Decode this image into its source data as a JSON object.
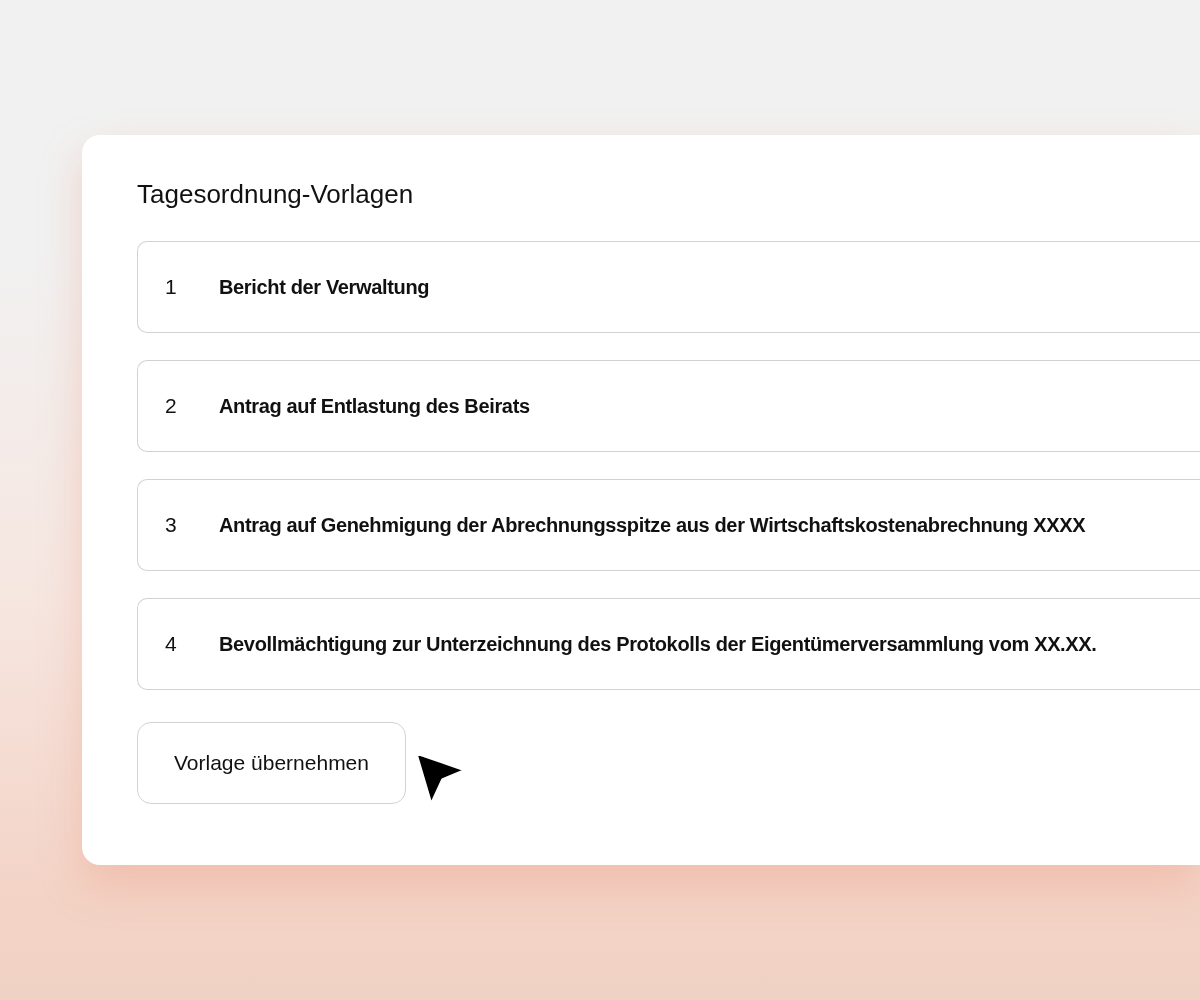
{
  "panel": {
    "title": "Tagesordnung-Vorlagen",
    "items": [
      {
        "number": "1",
        "title": "Bericht der Verwaltung"
      },
      {
        "number": "2",
        "title": "Antrag auf Entlastung des Beirats"
      },
      {
        "number": "3",
        "title": "Antrag auf Genehmigung der Abrechnungsspitze aus der Wirtschaftskostenabrechnung XXXX"
      },
      {
        "number": "4",
        "title": "Bevollmächtigung zur Unterzeichnung des Protokolls der Eigentümerversammlung vom XX.XX."
      }
    ],
    "button": "Vorlage übernehmen"
  }
}
